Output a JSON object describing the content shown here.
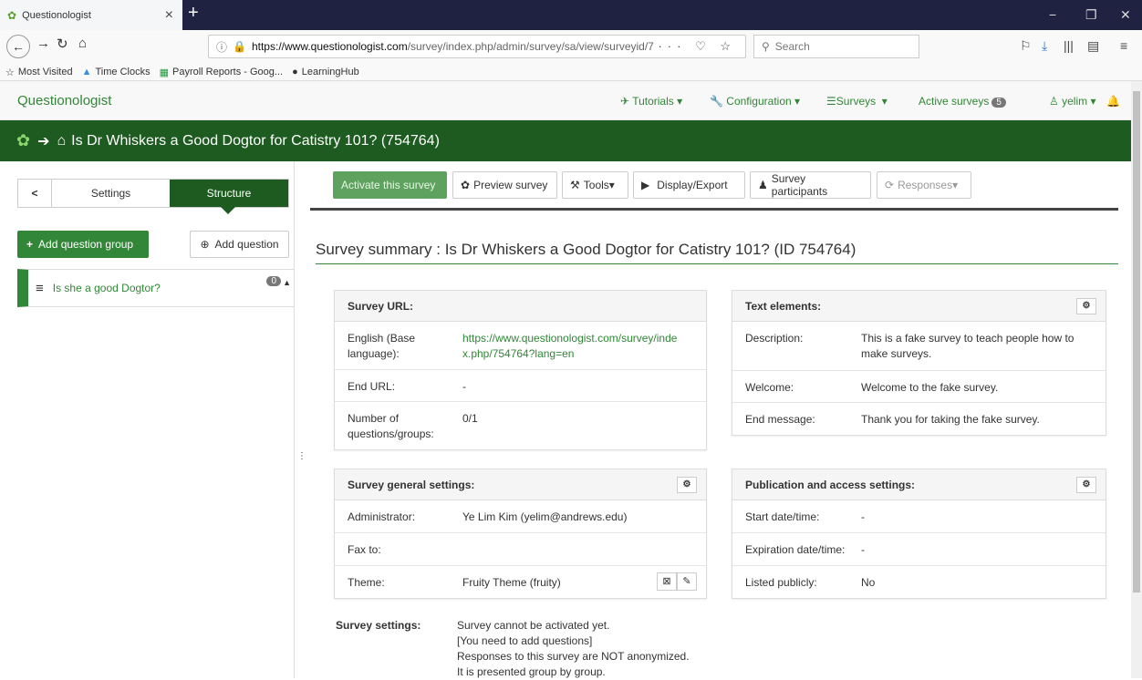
{
  "browser": {
    "tab_title": "Questionologist",
    "url_host": "https://www.questionologist.com",
    "url_rest": "/survey/index.php/admin/survey/sa/view/surveyid/7",
    "search_placeholder": "Search",
    "bookmarks": [
      "Most Visited",
      "Time Clocks",
      "Payroll Reports - Goog...",
      "LearningHub"
    ]
  },
  "appnav": {
    "brand": "Questionologist",
    "tutorials": "Tutorials",
    "configuration": "Configuration",
    "surveys": "Surveys",
    "active_surveys": "Active surveys",
    "active_count": "5",
    "user": "yelim"
  },
  "header": {
    "title": "Is Dr Whiskers a Good Dogtor for Catistry 101? (754764)"
  },
  "sidebar": {
    "back": "<",
    "settings_tab": "Settings",
    "structure_tab": "Structure",
    "add_group": "Add question group",
    "add_question": "Add question",
    "group_name": "Is she a good Dogtor?",
    "group_count": "0"
  },
  "toolbar": {
    "activate": "Activate this survey",
    "preview": "Preview survey",
    "tools": "Tools",
    "display": "Display/Export",
    "participants": "Survey participants",
    "responses": "Responses"
  },
  "summary": {
    "title": "Survey summary : Is Dr Whiskers a Good Dogtor for Catistry 101? (ID 754764)"
  },
  "survey_url": {
    "heading": "Survey URL:",
    "english_label": "English (Base language):",
    "english_url": "https://www.questionologist.com/survey/index.php/754764?lang=en",
    "end_url_label": "End URL:",
    "end_url_value": "-",
    "num_label": "Number of questions/groups:",
    "num_value": "0/1"
  },
  "text_elements": {
    "heading": "Text elements:",
    "description_label": "Description:",
    "description_value": "This is a fake survey to teach people how to make surveys.",
    "welcome_label": "Welcome:",
    "welcome_value": "Welcome to the fake survey.",
    "end_label": "End message:",
    "end_value": "Thank you for taking the fake survey."
  },
  "general": {
    "heading": "Survey general settings:",
    "admin_label": "Administrator:",
    "admin_value": "Ye Lim Kim (yelim@andrews.edu)",
    "fax_label": "Fax to:",
    "theme_label": "Theme:",
    "theme_value": "Fruity Theme (fruity)"
  },
  "publication": {
    "heading": "Publication and access settings:",
    "start_label": "Start date/time:",
    "start_value": "-",
    "exp_label": "Expiration date/time:",
    "exp_value": "-",
    "listed_label": "Listed publicly:",
    "listed_value": "No"
  },
  "survey_settings": {
    "label": "Survey settings:",
    "lines": [
      "Survey cannot be activated yet.",
      "[You need to add questions]",
      "Responses to this survey are NOT anonymized.",
      "It is presented group by group."
    ]
  }
}
